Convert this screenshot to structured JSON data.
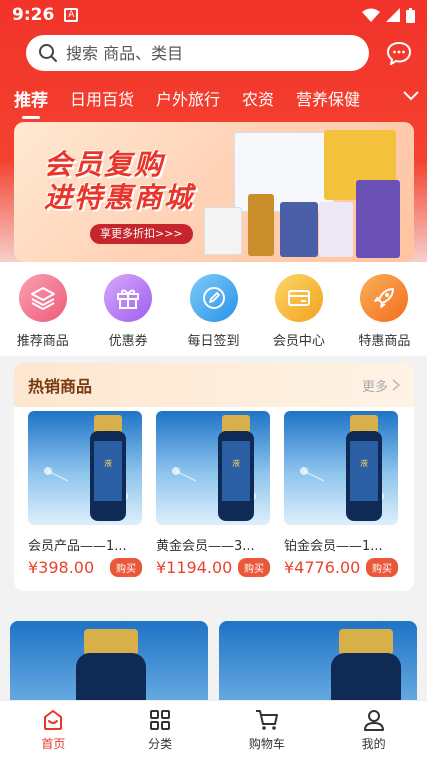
{
  "status": {
    "time": "9:26"
  },
  "search": {
    "placeholder": "搜索 商品、类目"
  },
  "categories": [
    {
      "label": "推荐"
    },
    {
      "label": "日用百货"
    },
    {
      "label": "户外旅行"
    },
    {
      "label": "农资"
    },
    {
      "label": "营养保健"
    }
  ],
  "banner": {
    "title_line1": "会员复购",
    "title_line2": "进特惠商城",
    "button": "享更多折扣>>>"
  },
  "quick_icons": [
    {
      "label": "推荐商品",
      "icon": "layers-icon",
      "color": "#f36d86"
    },
    {
      "label": "优惠券",
      "icon": "gift-icon",
      "color": "#b479f0"
    },
    {
      "label": "每日签到",
      "icon": "pen-icon",
      "color": "#39a6ee"
    },
    {
      "label": "会员中心",
      "icon": "card-icon",
      "color": "#f7b32a"
    },
    {
      "label": "特惠商品",
      "icon": "rocket-icon",
      "color": "#f57f2a"
    }
  ],
  "hot": {
    "title": "热销商品",
    "more": "更多",
    "items": [
      {
        "name": "会员产品——1...",
        "price": "¥398.00",
        "buy": "购买"
      },
      {
        "name": "黄金会员——3...",
        "price": "¥1194.00",
        "buy": "购买"
      },
      {
        "name": "铂金会员——1...",
        "price": "¥4776.00",
        "buy": "购买"
      }
    ]
  },
  "nav": [
    {
      "label": "首页",
      "icon": "home-icon"
    },
    {
      "label": "分类",
      "icon": "grid-icon"
    },
    {
      "label": "购物车",
      "icon": "cart-icon"
    },
    {
      "label": "我的",
      "icon": "user-icon"
    }
  ],
  "colors": {
    "brand": "#f2332a",
    "price": "#e8442d"
  }
}
